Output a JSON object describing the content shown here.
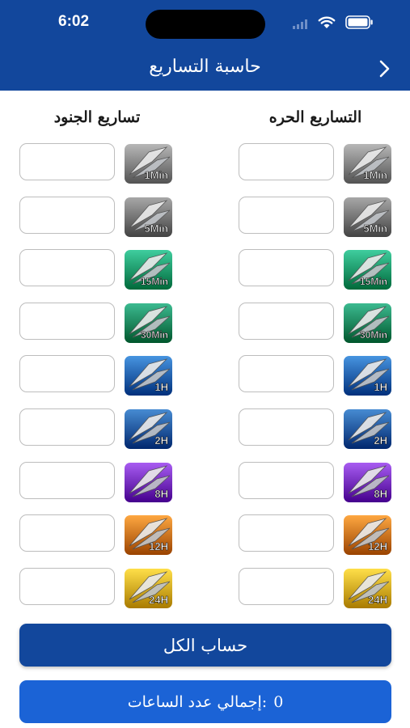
{
  "status_bar": {
    "time": "6:02"
  },
  "header": {
    "title": "حاسبة التساريع"
  },
  "columns": {
    "free_title": "التساريع الحره",
    "troops_title": "تساريع الجنود"
  },
  "rows": [
    {
      "label": "1Min",
      "color": "#8a8a8a"
    },
    {
      "label": "5Min",
      "color": "#7a7a7a"
    },
    {
      "label": "15Min",
      "color": "#12a071"
    },
    {
      "label": "30Min",
      "color": "#0f8d63"
    },
    {
      "label": "1H",
      "color": "#1a67b3"
    },
    {
      "label": "2H",
      "color": "#1a5ea5"
    },
    {
      "label": "8H",
      "color": "#7b2fc4"
    },
    {
      "label": "12H",
      "color": "#d17a14"
    },
    {
      "label": "24H",
      "color": "#e0b21c"
    }
  ],
  "free_values": [
    "",
    "",
    "",
    "",
    "",
    "",
    "",
    "",
    ""
  ],
  "troop_values": [
    "",
    "",
    "",
    "",
    "",
    "",
    "",
    "",
    ""
  ],
  "calc_button": {
    "label": "حساب الكل"
  },
  "total": {
    "label": "إجمالي عدد الساعات:",
    "value": "0"
  }
}
